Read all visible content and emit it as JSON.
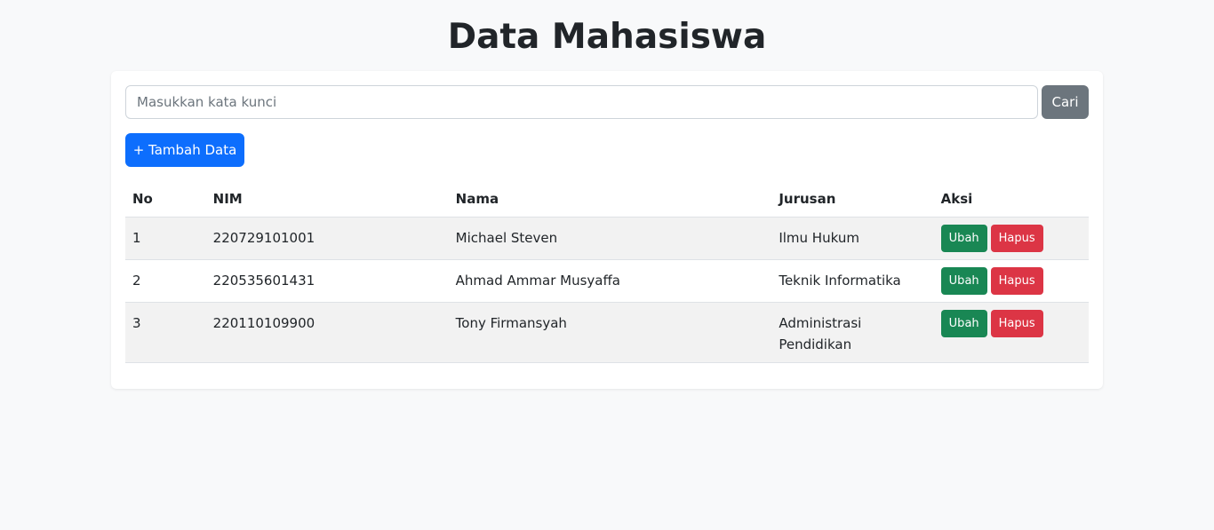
{
  "page": {
    "title": "Data Mahasiswa"
  },
  "search": {
    "placeholder": "Masukkan kata kunci",
    "value": "",
    "button_label": "Cari"
  },
  "actions": {
    "add_label": "+ Tambah Data"
  },
  "table": {
    "headers": {
      "no": "No",
      "nim": "NIM",
      "nama": "Nama",
      "jurusan": "Jurusan",
      "aksi": "Aksi"
    },
    "rows": [
      {
        "no": "1",
        "nim": "220729101001",
        "nama": "Michael Steven",
        "jurusan": "Ilmu Hukum",
        "edit_label": "Ubah",
        "delete_label": "Hapus"
      },
      {
        "no": "2",
        "nim": "220535601431",
        "nama": "Ahmad Ammar Musyaffa",
        "jurusan": "Teknik Informatika",
        "edit_label": "Ubah",
        "delete_label": "Hapus"
      },
      {
        "no": "3",
        "nim": "220110109900",
        "nama": "Tony Firmansyah",
        "jurusan": "Administrasi Pendidikan",
        "edit_label": "Ubah",
        "delete_label": "Hapus"
      }
    ]
  },
  "colors": {
    "background": "#f8f9fa",
    "primary": "#0d6efd",
    "secondary": "#6c757d",
    "success": "#198754",
    "danger": "#dc3545"
  }
}
